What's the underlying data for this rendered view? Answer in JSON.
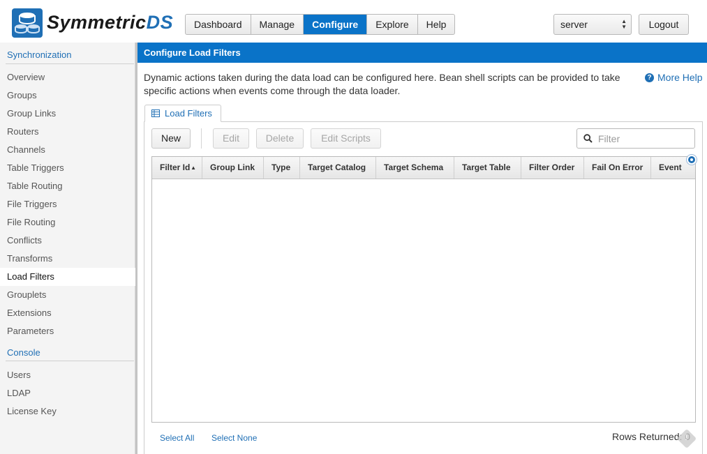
{
  "app": {
    "brand_main": "Symmetric",
    "brand_accent": "DS",
    "accent_color": "#0a73c8"
  },
  "topnav": {
    "items": [
      {
        "label": "Dashboard",
        "active": false
      },
      {
        "label": "Manage",
        "active": false
      },
      {
        "label": "Configure",
        "active": true
      },
      {
        "label": "Explore",
        "active": false
      },
      {
        "label": "Help",
        "active": false
      }
    ],
    "server_select": "server",
    "logout_label": "Logout"
  },
  "sidebar": {
    "section_sync": "Synchronization",
    "sync_items": [
      "Overview",
      "Groups",
      "Group Links",
      "Routers",
      "Channels",
      "Table Triggers",
      "Table Routing",
      "File Triggers",
      "File Routing",
      "Conflicts",
      "Transforms",
      "Load Filters",
      "Grouplets",
      "Extensions",
      "Parameters"
    ],
    "active_item": "Load Filters",
    "section_console": "Console",
    "console_items": [
      "Users",
      "LDAP",
      "License Key"
    ]
  },
  "main": {
    "title": "Configure Load Filters",
    "description": "Dynamic actions taken during the data load can be configured here. Bean shell scripts can be provided to take specific actions when events come through the data loader.",
    "more_help": "More Help",
    "tab_label": "Load Filters",
    "buttons": {
      "new": "New",
      "edit": "Edit",
      "delete": "Delete",
      "edit_scripts": "Edit Scripts"
    },
    "filter_placeholder": "Filter",
    "columns": [
      "Filter Id",
      "Group Link",
      "Type",
      "Target Catalog",
      "Target Schema",
      "Target Table",
      "Filter Order",
      "Fail On Error",
      "Event"
    ],
    "select_all": "Select All",
    "select_none": "Select None",
    "rows_returned": "Rows Returned: 0"
  }
}
